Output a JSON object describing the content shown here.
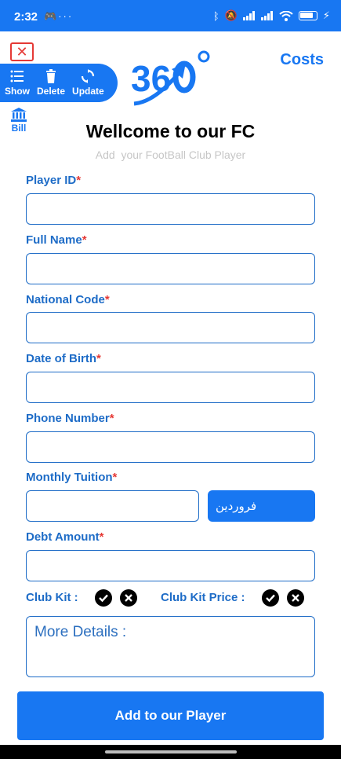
{
  "status_bar": {
    "time": "2:32",
    "left_icons": [
      "game-controller-icon",
      "more-dots-icon"
    ],
    "right_icons": [
      "bluetooth-icon",
      "mute-icon",
      "signal-icon",
      "signal-icon",
      "wifi-icon",
      "battery-icon"
    ]
  },
  "toolbar": {
    "show_label": "Show",
    "delete_label": "Delete",
    "update_label": "Update"
  },
  "bill_label": "Bill",
  "header": {
    "costs_label": "Costs"
  },
  "title": "Wellcome to our FC",
  "subtitle": "Add  your FootBall Club Player",
  "required_mark": "*",
  "form": {
    "player_id_label": "Player ID",
    "full_name_label": "Full Name",
    "national_code_label": "National Code",
    "date_of_birth_label": "Date of Birth",
    "phone_number_label": "Phone Number",
    "monthly_tuition_label": "Monthly Tuition",
    "month_value": "فروردین",
    "debt_amount_label": "Debt Amount",
    "club_kit_label": "Club Kit :",
    "club_kit_price_label": "Club Kit Price :",
    "more_details_placeholder": "More Details :"
  },
  "submit_label": "Add to our Player",
  "colors": {
    "primary": "#1877f2",
    "label_blue": "#1e6cc7",
    "required_red": "#e53935"
  }
}
